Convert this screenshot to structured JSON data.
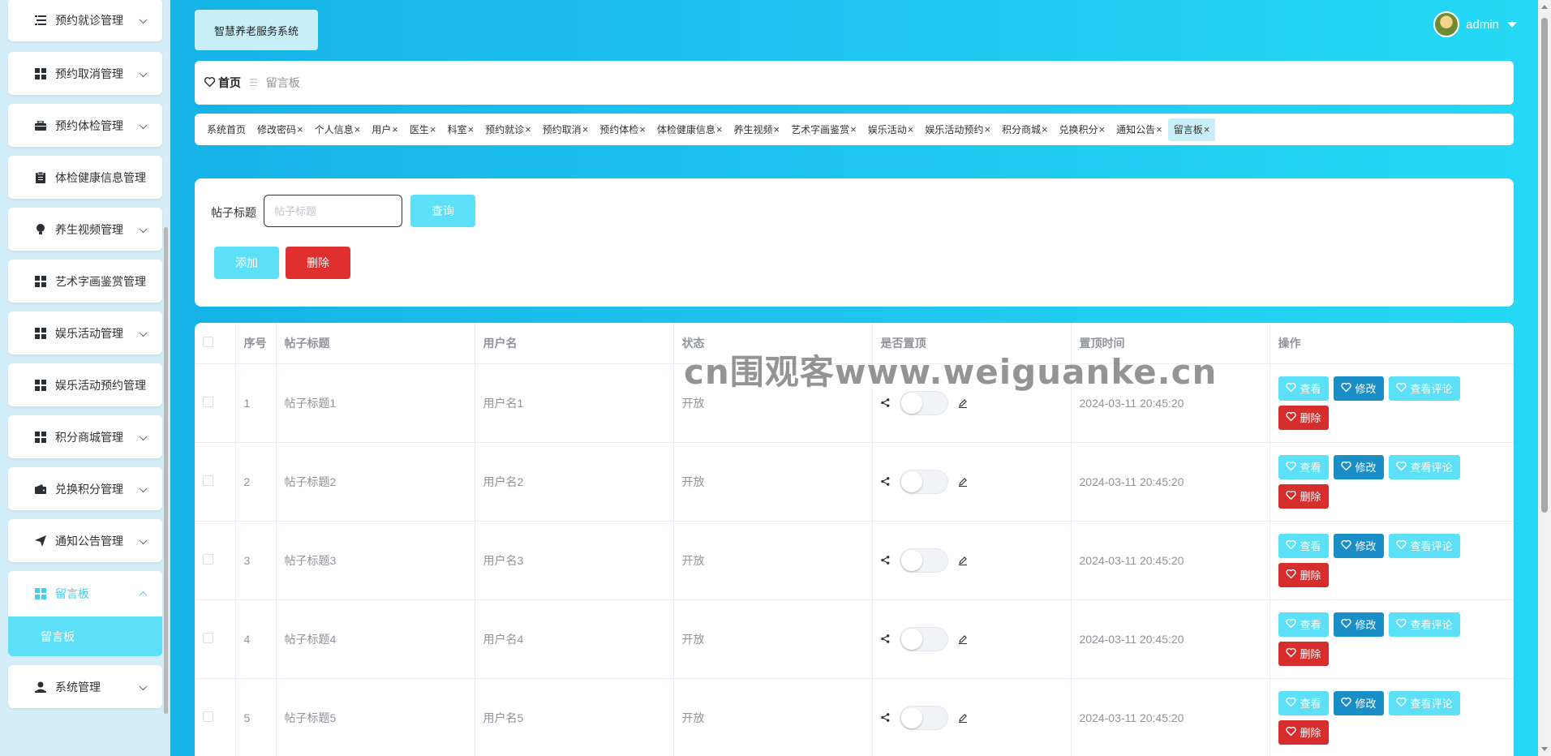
{
  "sidebar": {
    "items": [
      {
        "label": "预约就诊管理",
        "icon": "list-icon"
      },
      {
        "label": "预约取消管理",
        "icon": "grid-icon"
      },
      {
        "label": "预约体检管理",
        "icon": "briefcase-icon"
      },
      {
        "label": "体检健康信息管理",
        "icon": "clipboard-icon"
      },
      {
        "label": "养生视频管理",
        "icon": "bulb-icon"
      },
      {
        "label": "艺术字画鉴赏管理",
        "icon": "grid-icon"
      },
      {
        "label": "娱乐活动管理",
        "icon": "grid-icon"
      },
      {
        "label": "娱乐活动预约管理",
        "icon": "grid-icon"
      },
      {
        "label": "积分商城管理",
        "icon": "grid-icon"
      },
      {
        "label": "兑换积分管理",
        "icon": "wallet-icon"
      },
      {
        "label": "通知公告管理",
        "icon": "send-icon"
      },
      {
        "label": "留言板",
        "icon": "grid-icon"
      },
      {
        "label": "系统管理",
        "icon": "user-icon"
      }
    ],
    "sub_active": "留言板"
  },
  "header": {
    "brand": "智慧养老服务系统",
    "user": "admin"
  },
  "breadcrumb": {
    "home": "首页",
    "current": "留言板"
  },
  "tags": [
    {
      "label": "系统首页",
      "closable": false
    },
    {
      "label": "修改密码",
      "closable": true
    },
    {
      "label": "个人信息",
      "closable": true
    },
    {
      "label": "用户",
      "closable": true
    },
    {
      "label": "医生",
      "closable": true
    },
    {
      "label": "科室",
      "closable": true
    },
    {
      "label": "预约就诊",
      "closable": true
    },
    {
      "label": "预约取消",
      "closable": true
    },
    {
      "label": "预约体检",
      "closable": true
    },
    {
      "label": "体检健康信息",
      "closable": true
    },
    {
      "label": "养生视频",
      "closable": true
    },
    {
      "label": "艺术字画鉴赏",
      "closable": true
    },
    {
      "label": "娱乐活动",
      "closable": true
    },
    {
      "label": "娱乐活动预约",
      "closable": true
    },
    {
      "label": "积分商城",
      "closable": true
    },
    {
      "label": "兑换积分",
      "closable": true
    },
    {
      "label": "通知公告",
      "closable": true
    },
    {
      "label": "留言板",
      "closable": true,
      "active": true
    }
  ],
  "search": {
    "label": "帖子标题",
    "placeholder": "帖子标题",
    "query_btn": "查询",
    "add_btn": "添加",
    "delete_btn": "删除"
  },
  "table": {
    "headers": [
      "序号",
      "帖子标题",
      "用户名",
      "状态",
      "是否置顶",
      "置顶时间",
      "操作"
    ],
    "rows": [
      {
        "index": "1",
        "title": "帖子标题1",
        "username": "用户名1",
        "status": "开放",
        "top_time": "2024-03-11 20:45:20"
      },
      {
        "index": "2",
        "title": "帖子标题2",
        "username": "用户名2",
        "status": "开放",
        "top_time": "2024-03-11 20:45:20"
      },
      {
        "index": "3",
        "title": "帖子标题3",
        "username": "用户名3",
        "status": "开放",
        "top_time": "2024-03-11 20:45:20"
      },
      {
        "index": "4",
        "title": "帖子标题4",
        "username": "用户名4",
        "status": "开放",
        "top_time": "2024-03-11 20:45:20"
      },
      {
        "index": "5",
        "title": "帖子标题5",
        "username": "用户名5",
        "status": "开放",
        "top_time": "2024-03-11 20:45:20"
      }
    ],
    "actions": {
      "view": "查看",
      "edit": "修改",
      "comments": "查看评论",
      "delete": "删除"
    }
  },
  "watermark": "cn围观客www.weiguanke.cn",
  "colors": {
    "accent": "#5ce0f7",
    "edit_blue": "#1a8fc7",
    "danger": "#e02f2f",
    "header_gradient_start": "#16b3e6",
    "header_gradient_end": "#25d9f5",
    "sidebar_bg": "#d3eef9"
  }
}
